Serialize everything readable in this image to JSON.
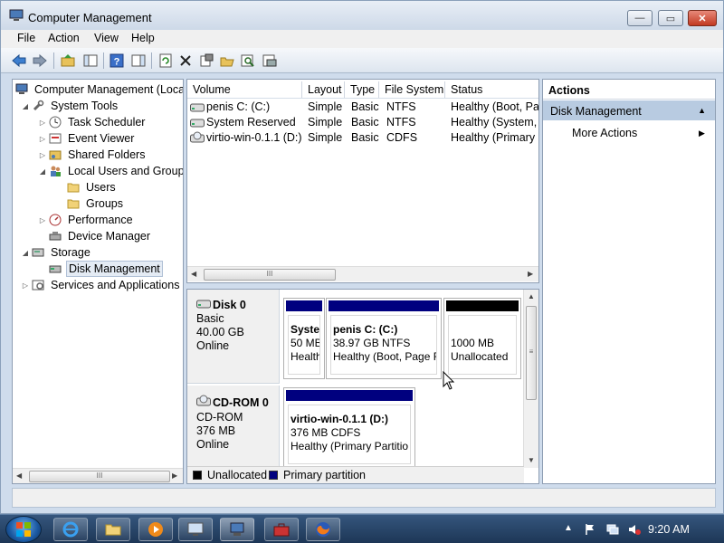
{
  "window": {
    "title": "Computer Management",
    "min_glyph": "—",
    "max_glyph": "▭",
    "close_glyph": "✕"
  },
  "menu": [
    "File",
    "Action",
    "View",
    "Help"
  ],
  "toolbar_icons": [
    "back-icon",
    "forward-icon",
    "up-folder-icon",
    "show-hide-tree-icon",
    "help-icon",
    "show-hide-action-pane-icon",
    "refresh-icon",
    "delete-icon",
    "properties-icon",
    "open-icon",
    "search-icon",
    "disk-icon"
  ],
  "tree": {
    "root": "Computer Management (Local",
    "system_tools": "System Tools",
    "task_scheduler": "Task Scheduler",
    "event_viewer": "Event Viewer",
    "shared_folders": "Shared Folders",
    "local_users_groups": "Local Users and Groups",
    "users": "Users",
    "groups": "Groups",
    "performance": "Performance",
    "device_manager": "Device Manager",
    "storage": "Storage",
    "disk_management": "Disk Management",
    "services_apps": "Services and Applications"
  },
  "volumes": {
    "columns": [
      "Volume",
      "Layout",
      "Type",
      "File System",
      "Status"
    ],
    "rows": [
      {
        "volume": "penis C: (C:)",
        "layout": "Simple",
        "type": "Basic",
        "fs": "NTFS",
        "status": "Healthy (Boot, Pag"
      },
      {
        "volume": "System Reserved",
        "layout": "Simple",
        "type": "Basic",
        "fs": "NTFS",
        "status": "Healthy (System, A"
      },
      {
        "volume": "virtio-win-0.1.1 (D:)",
        "layout": "Simple",
        "type": "Basic",
        "fs": "CDFS",
        "status": "Healthy (Primary P"
      }
    ]
  },
  "disks": {
    "disk0": {
      "name": "Disk 0",
      "type": "Basic",
      "size": "40.00 GB",
      "state": "Online",
      "partitions": [
        {
          "name": "Syster",
          "size": "50 MB",
          "status": "Healthi"
        },
        {
          "name": "penis C:  (C:)",
          "size": "38.97 GB NTFS",
          "status": "Healthy (Boot, Page F"
        },
        {
          "name": "",
          "size": "1000 MB",
          "status": "Unallocated"
        }
      ]
    },
    "cdrom0": {
      "name": "CD-ROM 0",
      "type": "CD-ROM",
      "size": "376 MB",
      "state": "Online",
      "partitions": [
        {
          "name": "virtio-win-0.1.1  (D:)",
          "size": "376 MB CDFS",
          "status": "Healthy (Primary Partitio"
        }
      ]
    },
    "legend": {
      "unallocated": "Unallocated",
      "primary": "Primary partition"
    }
  },
  "actions": {
    "header": "Actions",
    "section": "Disk Management",
    "more": "More Actions"
  },
  "scroll_grip": "III",
  "taskbar": {
    "clock": "9:20 AM",
    "apps": [
      "internet-explorer-icon",
      "windows-explorer-icon",
      "media-player-icon",
      "remote-desktop-icon",
      "computer-management-icon",
      "toolbox-icon",
      "firefox-icon"
    ]
  },
  "colors": {
    "primary_partition": "#00007f",
    "unallocated": "#000000",
    "selection": "#e4ebf4",
    "actions_section": "#b8cbe1"
  }
}
